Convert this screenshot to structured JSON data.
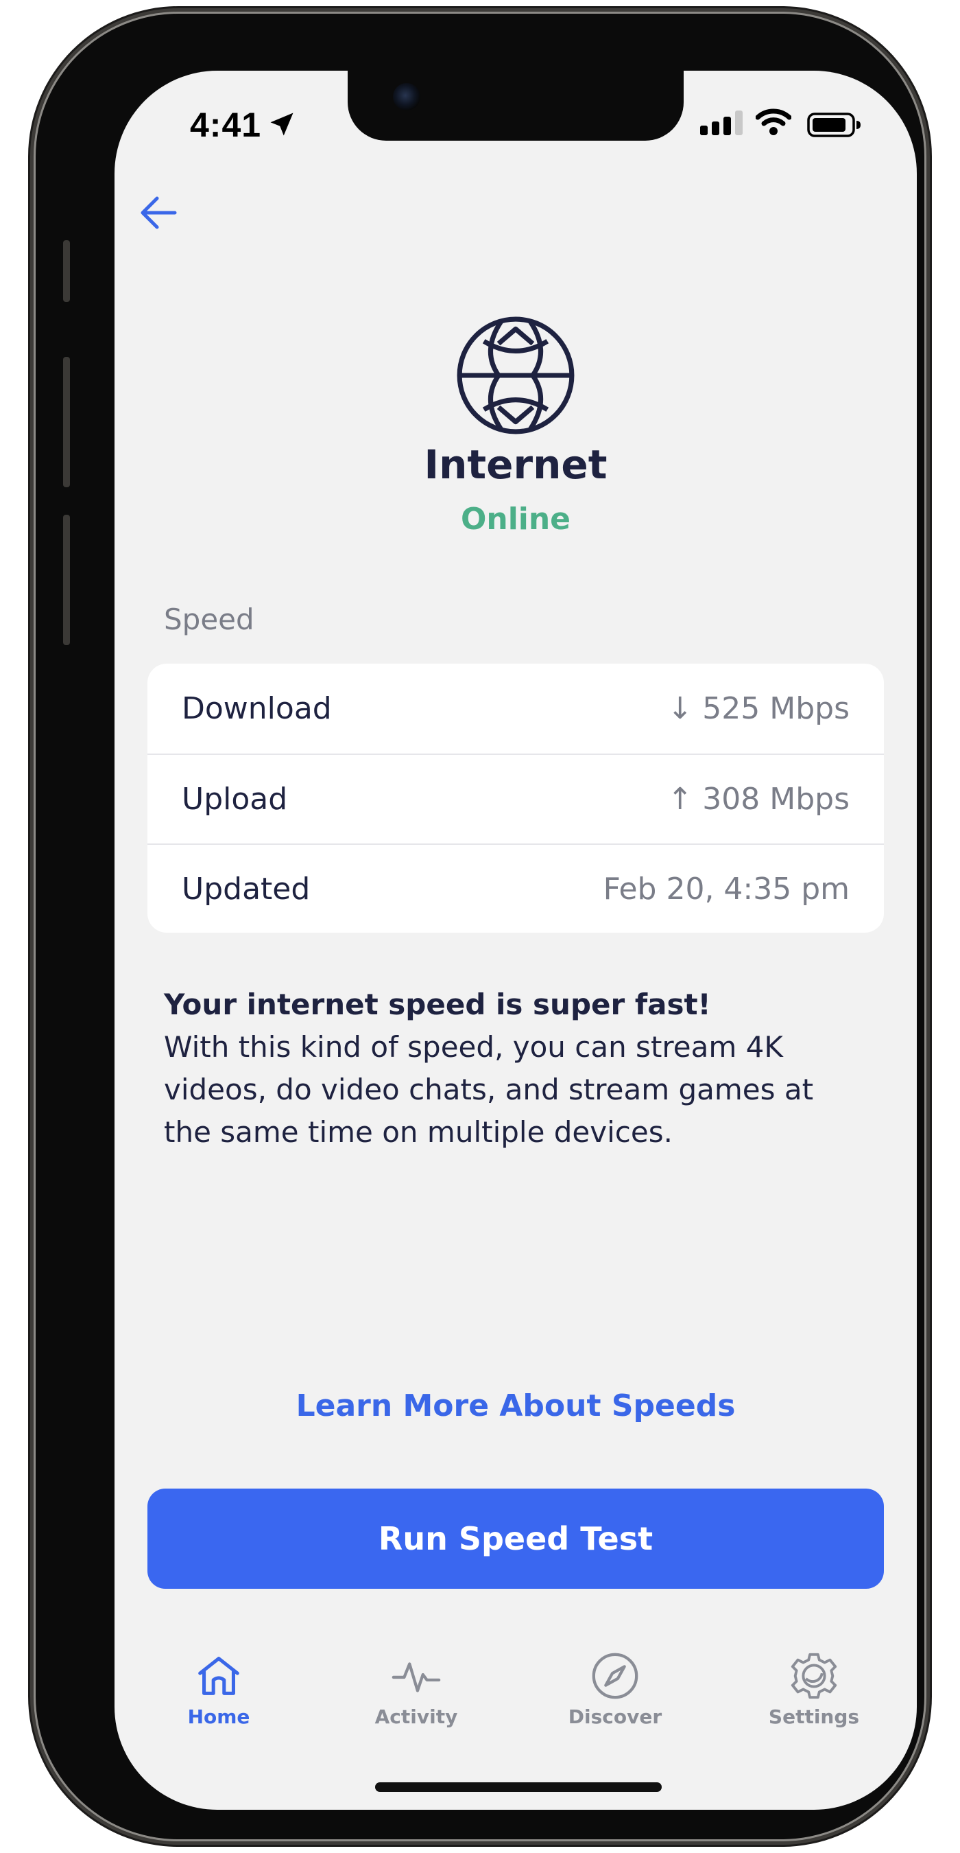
{
  "status_bar": {
    "time": "4:41",
    "icons": [
      "location-arrow-icon",
      "cellular-signal-icon",
      "wifi-icon",
      "battery-icon"
    ]
  },
  "header": {
    "back_icon": "arrow-left-icon",
    "device_icon": "globe-icon",
    "title": "Internet",
    "status": "Online"
  },
  "speed": {
    "section_label": "Speed",
    "rows": [
      {
        "label": "Download",
        "value": "↓ 525 Mbps"
      },
      {
        "label": "Upload",
        "value": "↑ 308 Mbps"
      },
      {
        "label": "Updated",
        "value": "Feb 20, 4:35 pm"
      }
    ]
  },
  "description": {
    "heading": "Your internet speed is super fast!",
    "body": "With this kind of speed, you can stream 4K videos, do video chats, and stream games at the same time on multiple devices."
  },
  "actions": {
    "learn_more": "Learn More About Speeds",
    "run_test": "Run Speed Test"
  },
  "tab_bar": {
    "tabs": [
      {
        "label": "Home",
        "icon": "home-icon",
        "active": true
      },
      {
        "label": "Activity",
        "icon": "activity-pulse-icon",
        "active": false
      },
      {
        "label": "Discover",
        "icon": "compass-icon",
        "active": false
      },
      {
        "label": "Settings",
        "icon": "gear-icon",
        "active": false
      }
    ]
  },
  "colors": {
    "accent": "#3a67f0",
    "online_green": "#4caf88",
    "text_dark": "#1e2240",
    "text_muted": "#7a7d88",
    "background": "#f2f2f2"
  }
}
